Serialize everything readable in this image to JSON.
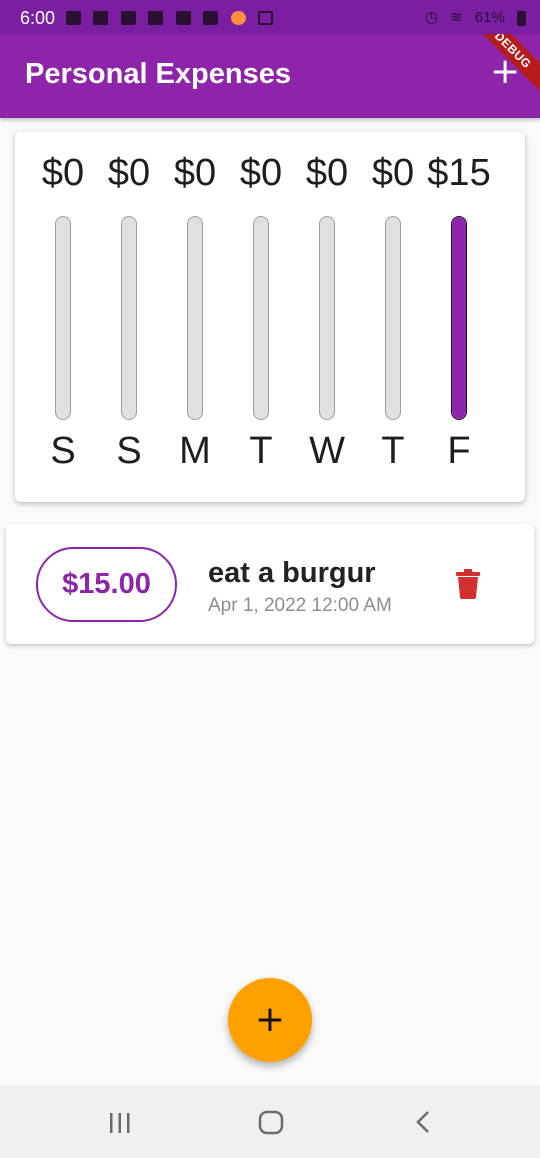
{
  "status_bar": {
    "time": "6:00",
    "battery": "61%"
  },
  "app_bar": {
    "title": "Personal Expenses",
    "add_icon": "plus-icon",
    "debug_label": "DEBUG"
  },
  "chart": {
    "bars": [
      {
        "day": "S",
        "amount": "$0",
        "fill_fraction": 0
      },
      {
        "day": "S",
        "amount": "$0",
        "fill_fraction": 0
      },
      {
        "day": "M",
        "amount": "$0",
        "fill_fraction": 0
      },
      {
        "day": "T",
        "amount": "$0",
        "fill_fraction": 0
      },
      {
        "day": "W",
        "amount": "$0",
        "fill_fraction": 0
      },
      {
        "day": "T",
        "amount": "$0",
        "fill_fraction": 0
      },
      {
        "day": "F",
        "amount": "$15",
        "fill_fraction": 1
      }
    ],
    "fill_color": "#8e24aa",
    "track_color": "#e0e0e0"
  },
  "transactions": [
    {
      "amount": "$15.00",
      "title": "eat a burgur",
      "date": "Apr 1, 2022 12:00 AM",
      "delete_icon": "trash-icon"
    }
  ],
  "fab": {
    "icon": "plus-icon",
    "color": "#ffa000"
  },
  "colors": {
    "primary": "#8e24aa",
    "accent": "#ffa000",
    "delete": "#d32f2f"
  }
}
